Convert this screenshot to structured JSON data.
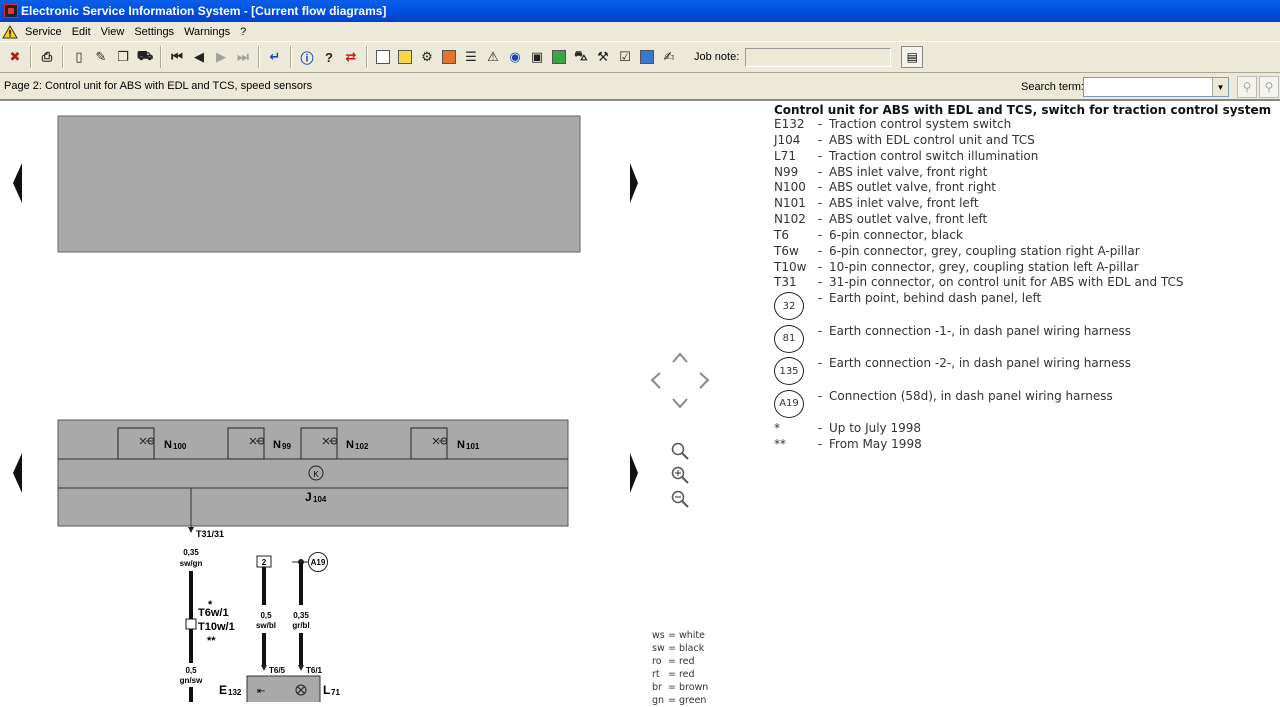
{
  "window": {
    "title": "Electronic Service Information System - [Current flow diagrams]"
  },
  "menu": {
    "items": [
      "Service",
      "Edit",
      "View",
      "Settings",
      "Warnings",
      "?"
    ]
  },
  "toolbar": {
    "job_note_label": "Job note:",
    "job_note_value": ""
  },
  "pagebar": {
    "page_label": "Page 2: Control unit for ABS with EDL and TCS, speed sensors",
    "search_label": "Search term:",
    "search_value": ""
  },
  "diagram": {
    "components": {
      "n100": "N",
      "n100_sub": "100",
      "n99": "N",
      "n99_sub": "99",
      "n102": "N",
      "n102_sub": "102",
      "n101": "N",
      "n101_sub": "101",
      "j104": "J",
      "j104_sub": "104",
      "k_symbol": "K"
    },
    "wires": {
      "t31_label": "T31/31",
      "w1_size": "0,35",
      "w1_color": "sw/gn",
      "t6w": "T6w/1",
      "t10w": "T10w/1",
      "star1": "*",
      "star2": "**",
      "w2_size": "0,5",
      "w2_color": "gn/sw",
      "box2": "2",
      "w3_size": "0,5",
      "w3_color": "sw/bl",
      "w4_size": "0,35",
      "w4_color": "gr/bl",
      "a19": "A19",
      "t65": "T6/5",
      "t61": "T6/1",
      "e132": "E",
      "e132_sub": "132",
      "l71": "L",
      "l71_sub": "71"
    }
  },
  "legend": {
    "title": "Control unit for ABS with EDL and TCS, switch for traction control system",
    "items": [
      {
        "code": "E132",
        "desc": "Traction control system switch"
      },
      {
        "code": "J104",
        "desc": "ABS with EDL control unit and TCS"
      },
      {
        "code": "L71",
        "desc": "Traction control switch illumination"
      },
      {
        "code": "N99",
        "desc": "ABS inlet valve, front right"
      },
      {
        "code": "N100",
        "desc": "ABS outlet valve, front right"
      },
      {
        "code": "N101",
        "desc": "ABS inlet valve, front left"
      },
      {
        "code": "N102",
        "desc": "ABS outlet valve, front left"
      },
      {
        "code": "T6",
        "desc": "6-pin connector, black"
      },
      {
        "code": "T6w",
        "desc": "6-pin connector, grey, coupling station right A-pillar"
      },
      {
        "code": "T10w",
        "desc": "10-pin connector, grey, coupling station left A-pillar"
      },
      {
        "code": "T31",
        "desc": "31-pin connector, on control unit for ABS with EDL and TCS"
      }
    ],
    "earth": [
      {
        "code": "32",
        "desc": "Earth point, behind dash panel, left"
      },
      {
        "code": "81",
        "desc": "Earth connection -1-, in dash panel wiring harness"
      },
      {
        "code": "135",
        "desc": "Earth connection -2-, in dash panel wiring harness"
      },
      {
        "code": "A19",
        "desc": "Connection (58d), in dash panel wiring harness"
      }
    ],
    "notes": [
      {
        "code": "*",
        "desc": "Up to July 1998"
      },
      {
        "code": "**",
        "desc": "From May 1998"
      }
    ]
  },
  "color_codes": [
    {
      "k": "ws",
      "v": "white"
    },
    {
      "k": "sw",
      "v": "black"
    },
    {
      "k": "ro",
      "v": "red"
    },
    {
      "k": "rt",
      "v": "red"
    },
    {
      "k": "br",
      "v": "brown"
    },
    {
      "k": "gn",
      "v": "green"
    }
  ]
}
